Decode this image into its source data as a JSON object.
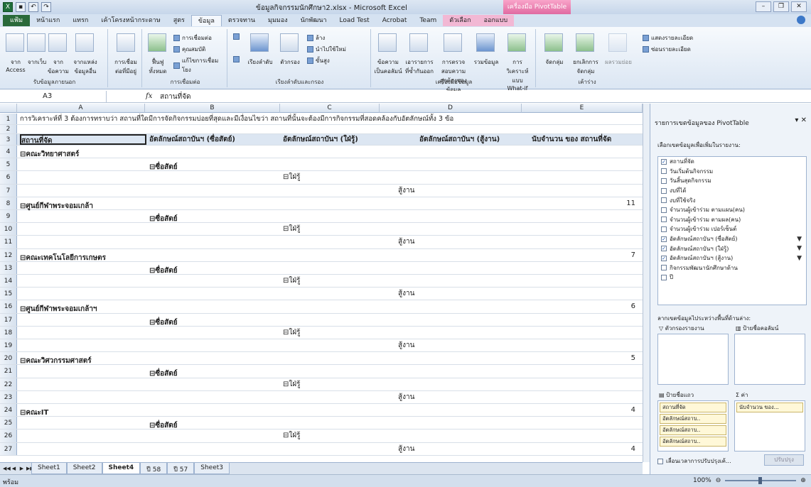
{
  "title_bar": {
    "doc_title": "ข้อมูลกิจกรรมนักศึกษา2.xlsx - Microsoft Excel",
    "context_tab": "เครื่องมือ PivotTable"
  },
  "ribbon_tabs": [
    "แฟ้ม",
    "หน้าแรก",
    "แทรก",
    "เค้าโครงหน้ากระดาษ",
    "สูตร",
    "ข้อมูล",
    "ตรวจทาน",
    "มุมมอง",
    "นักพัฒนา",
    "Load Test",
    "Acrobat",
    "Team",
    "ตัวเลือก",
    "ออกแบบ"
  ],
  "ribbon_groups": {
    "external": "รับข้อมูลภายนอก",
    "connections": "การเชื่อมต่อ",
    "sort_filter": "เรียงลำดับและกรอง",
    "data_tools": "เครื่องมือข้อมูล",
    "outline": "เค้าร่าง",
    "show_detail": "แสดงรายละเอียด",
    "hide_detail": "ซ่อนรายละเอียด",
    "btn_access": "จาก Access",
    "btn_web": "จากเว็บ",
    "btn_text": "จากข้อความ",
    "btn_other": "จากแหล่งข้อมูลอื่น",
    "btn_existing": "การเชื่อมต่อที่มีอยู่",
    "btn_refresh": "ฟื้นฟูทั้งหมด",
    "conn_1": "การเชื่อมต่อ",
    "conn_2": "คุณสมบัติ",
    "conn_3": "แก้ไขการเชื่อมโยง",
    "btn_sort": "เรียงลำดับ",
    "btn_filter": "ตัวกรอง",
    "btn_clear": "ล้าง",
    "btn_reapply": "นำไปใช้ใหม่",
    "btn_advanced": "ขั้นสูง",
    "btn_t2c": "ข้อความเป็นคอลัมน์",
    "btn_dup": "เอารายการที่ซ้ำกันออก",
    "btn_valid": "การตรวจสอบความถูกต้องของข้อมูล",
    "btn_consol": "รวมข้อมูล",
    "btn_whatif": "การวิเคราะห์แบบ What-if",
    "btn_group": "จัดกลุ่ม",
    "btn_ungroup": "ยกเลิกการจัดกลุ่ม",
    "btn_subtotal": "ผลรวมย่อย"
  },
  "formula_bar": {
    "name_box": "A3",
    "fx": "fx",
    "value": "สถานที่จัด"
  },
  "columns": [
    "A",
    "B",
    "C",
    "D",
    "E"
  ],
  "row1": "การวิเคราะห์ที่ 3 ต้องการทราบว่า  สถานที่ใดมีการจัดกิจกรรมบ่อยที่สุดและมีเงื่อนไขว่า  สถานที่นั้นจะต้องมีการกิจกรรมที่สอดคล้องกับอัตลักษณ์ทั้ง  3 ข้อ",
  "pivot_headers": [
    "สถานที่จัด",
    "อัตลักษณ์สถาบันฯ (ซื่อสัตย์)",
    "อัตลักษณ์สถาบันฯ (ใฝ่รู้)",
    "อัตลักษณ์สถาบันฯ (สู้งาน)",
    "นับจำนวน ของ สถานที่จัด"
  ],
  "rows": [
    {
      "n": "4",
      "a": "⊟คณะวิทยาศาสตร์",
      "b": "",
      "c": "",
      "d": "",
      "e": ""
    },
    {
      "n": "5",
      "a": "",
      "b": "⊟ซื่อสัตย์",
      "c": "",
      "d": "",
      "e": ""
    },
    {
      "n": "6",
      "a": "",
      "b": "",
      "c": "⊟ใฝ่รู้",
      "d": "",
      "e": ""
    },
    {
      "n": "7",
      "a": "",
      "b": "",
      "c": "",
      "d": "สู้งาน",
      "e": ""
    },
    {
      "n": "8",
      "a": "⊟ศูนย์กีฬาพระจอมเกล้า",
      "b": "",
      "c": "",
      "d": "",
      "e": "11"
    },
    {
      "n": "9",
      "a": "",
      "b": "⊟ซื่อสัตย์",
      "c": "",
      "d": "",
      "e": ""
    },
    {
      "n": "10",
      "a": "",
      "b": "",
      "c": "⊟ใฝ่รู้",
      "d": "",
      "e": ""
    },
    {
      "n": "11",
      "a": "",
      "b": "",
      "c": "",
      "d": "สู้งาน",
      "e": ""
    },
    {
      "n": "12",
      "a": "⊟คณะเทคโนโลยีการเกษตร",
      "b": "",
      "c": "",
      "d": "",
      "e": "7"
    },
    {
      "n": "13",
      "a": "",
      "b": "⊟ซื่อสัตย์",
      "c": "",
      "d": "",
      "e": ""
    },
    {
      "n": "14",
      "a": "",
      "b": "",
      "c": "⊟ใฝ่รู้",
      "d": "",
      "e": ""
    },
    {
      "n": "15",
      "a": "",
      "b": "",
      "c": "",
      "d": "สู้งาน",
      "e": ""
    },
    {
      "n": "16",
      "a": "⊟ศูนย์กีฬาพระจอมเกล้าฯ",
      "b": "",
      "c": "",
      "d": "",
      "e": "6"
    },
    {
      "n": "17",
      "a": "",
      "b": "⊟ซื่อสัตย์",
      "c": "",
      "d": "",
      "e": ""
    },
    {
      "n": "18",
      "a": "",
      "b": "",
      "c": "⊟ใฝ่รู้",
      "d": "",
      "e": ""
    },
    {
      "n": "19",
      "a": "",
      "b": "",
      "c": "",
      "d": "สู้งาน",
      "e": ""
    },
    {
      "n": "20",
      "a": "⊟คณะวิศวกรรมศาสตร์",
      "b": "",
      "c": "",
      "d": "",
      "e": "5"
    },
    {
      "n": "21",
      "a": "",
      "b": "⊟ซื่อสัตย์",
      "c": "",
      "d": "",
      "e": ""
    },
    {
      "n": "22",
      "a": "",
      "b": "",
      "c": "⊟ใฝ่รู้",
      "d": "",
      "e": ""
    },
    {
      "n": "23",
      "a": "",
      "b": "",
      "c": "",
      "d": "สู้งาน",
      "e": ""
    },
    {
      "n": "24",
      "a": "⊟คณะIT",
      "b": "",
      "c": "",
      "d": "",
      "e": "4"
    },
    {
      "n": "25",
      "a": "",
      "b": "⊟ซื่อสัตย์",
      "c": "",
      "d": "",
      "e": ""
    },
    {
      "n": "26",
      "a": "",
      "b": "",
      "c": "⊟ใฝ่รู้",
      "d": "",
      "e": ""
    },
    {
      "n": "27",
      "a": "",
      "b": "",
      "c": "",
      "d": "สู้งาน",
      "e": "4"
    }
  ],
  "sheet_tabs": [
    "Sheet1",
    "Sheet2",
    "Sheet4",
    "ปี 58",
    "ปี 57",
    "Sheet3"
  ],
  "active_sheet": "Sheet4",
  "status": {
    "ready": "พร้อม",
    "zoom": "100%"
  },
  "pivot_panel": {
    "title": "รายการเขตข้อมูลของ PivotTable",
    "choose_label": "เลือกเขตข้อมูลเพื่อเพิ่มในรายงาน:",
    "fields": [
      {
        "label": "สถานที่จัด",
        "checked": true,
        "filter": false
      },
      {
        "label": "วันเริ่มต้นกิจกรรม",
        "checked": false,
        "filter": false
      },
      {
        "label": "วันสิ้นสุดกิจกรรม",
        "checked": false,
        "filter": false
      },
      {
        "label": "งบที่ได้",
        "checked": false,
        "filter": false
      },
      {
        "label": "งบที่ใช้จริง",
        "checked": false,
        "filter": false
      },
      {
        "label": "จำนวนผู้เข้าร่วม ตามแผน(คน)",
        "checked": false,
        "filter": false
      },
      {
        "label": "จำนวนผู้เข้าร่วม ตามผล(คน)",
        "checked": false,
        "filter": false
      },
      {
        "label": "จำนวนผู้เข้าร่วม เปอร์เซ็นต์",
        "checked": false,
        "filter": false
      },
      {
        "label": "อัตลักษณ์สถาบันฯ (ซื่อสัตย์)",
        "checked": true,
        "filter": true
      },
      {
        "label": "อัตลักษณ์สถาบันฯ (ใฝ่รู้)",
        "checked": true,
        "filter": true
      },
      {
        "label": "อัตลักษณ์สถาบันฯ (สู้งาน)",
        "checked": true,
        "filter": true
      },
      {
        "label": "กิจกรรมพัฒนานักศึกษาด้าน",
        "checked": false,
        "filter": false
      },
      {
        "label": "ปี",
        "checked": false,
        "filter": false
      }
    ],
    "drag_label": "ลากเขตข้อมูลไประหว่างพื้นที่ด้านล่าง:",
    "zone_filter": "ตัวกรองรายงาน",
    "zone_columns": "ป้ายชื่อคอลัมน์",
    "zone_rows": "ป้ายชื่อแถว",
    "zone_values": "ค่า",
    "row_chips": [
      "สถานที่จัด",
      "อัตลักษณ์สถาบ..",
      "อัตลักษณ์สถาบ..",
      "อัตลักษณ์สถาบ.."
    ],
    "value_chips": [
      "นับจำนวน ของ..."
    ],
    "defer_label": "เลื่อนเวลาการปรับปรุงเค้...",
    "update_label": "ปรับปรุง"
  }
}
